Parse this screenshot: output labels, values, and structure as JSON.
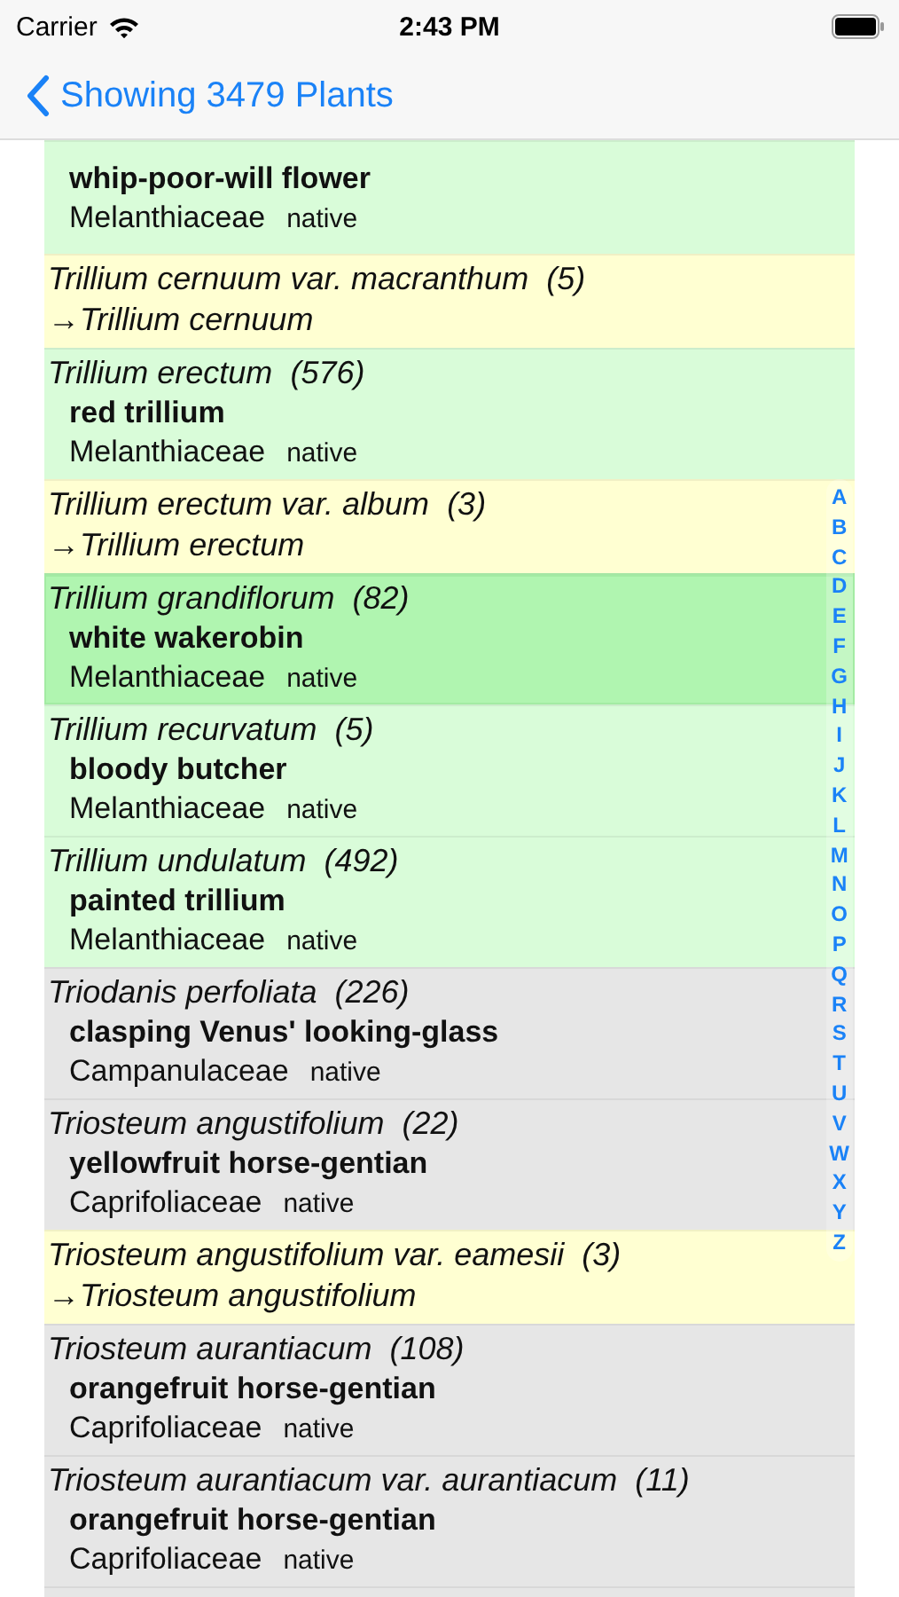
{
  "status_bar": {
    "carrier": "Carrier",
    "time": "2:43 PM"
  },
  "nav": {
    "back_label": "Showing 3479 Plants"
  },
  "rows": [
    {
      "kind": "plant",
      "common": "whip-poor-will flower",
      "family": "Melanthiaceae",
      "status": "native",
      "color": "#d9fcd9",
      "selected": false
    },
    {
      "kind": "synonym",
      "name": "Trillium cernuum var. macranthum",
      "count": "(5)",
      "target": "→Trillium cernuum",
      "color": "#ffffd2",
      "selected": false
    },
    {
      "kind": "plant",
      "name": "Trillium erectum",
      "count": "(576)",
      "common": "red trillium",
      "family": "Melanthiaceae",
      "status": "native",
      "color": "#d9fcd9",
      "selected": false
    },
    {
      "kind": "synonym",
      "name": "Trillium erectum var. album",
      "count": "(3)",
      "target": "→Trillium erectum",
      "color": "#ffffd2",
      "selected": false
    },
    {
      "kind": "plant",
      "name": "Trillium grandiflorum",
      "count": "(82)",
      "common": "white wakerobin",
      "family": "Melanthiaceae",
      "status": "native",
      "color": "#b0f5b0",
      "selected": true
    },
    {
      "kind": "plant",
      "name": "Trillium recurvatum",
      "count": "(5)",
      "common": "bloody butcher",
      "family": "Melanthiaceae",
      "status": "native",
      "color": "#d9fcd9",
      "selected": false
    },
    {
      "kind": "plant",
      "name": "Trillium undulatum",
      "count": "(492)",
      "common": "painted trillium",
      "family": "Melanthiaceae",
      "status": "native",
      "color": "#d9fcd9",
      "selected": false
    },
    {
      "kind": "plant",
      "name": "Triodanis perfoliata",
      "count": "(226)",
      "common": "clasping Venus' looking-glass",
      "family": "Campanulaceae",
      "status": "native",
      "color": "#e6e6e6",
      "selected": false
    },
    {
      "kind": "plant",
      "name": "Triosteum angustifolium",
      "count": "(22)",
      "common": "yellowfruit horse-gentian",
      "family": "Caprifoliaceae",
      "status": "native",
      "color": "#e6e6e6",
      "selected": false
    },
    {
      "kind": "synonym",
      "name": "Triosteum angustifolium var. eamesii",
      "count": "(3)",
      "target": "→Triosteum angustifolium",
      "color": "#ffffd2",
      "selected": false
    },
    {
      "kind": "plant",
      "name": "Triosteum aurantiacum",
      "count": "(108)",
      "common": "orangefruit horse-gentian",
      "family": "Caprifoliaceae",
      "status": "native",
      "color": "#e6e6e6",
      "selected": false
    },
    {
      "kind": "plant",
      "name": "Triosteum aurantiacum var. aurantiacum",
      "count": "(11)",
      "common": "orangefruit horse-gentian",
      "family": "Caprifoliaceae",
      "status": "native",
      "color": "#e6e6e6",
      "selected": false
    },
    {
      "kind": "plant",
      "color": "#e6e6e6",
      "selected": false
    }
  ],
  "index": [
    "A",
    "B",
    "C",
    "D",
    "E",
    "F",
    "G",
    "H",
    "I",
    "J",
    "K",
    "L",
    "M",
    "N",
    "O",
    "P",
    "Q",
    "R",
    "S",
    "T",
    "U",
    "V",
    "W",
    "X",
    "Y",
    "Z"
  ]
}
